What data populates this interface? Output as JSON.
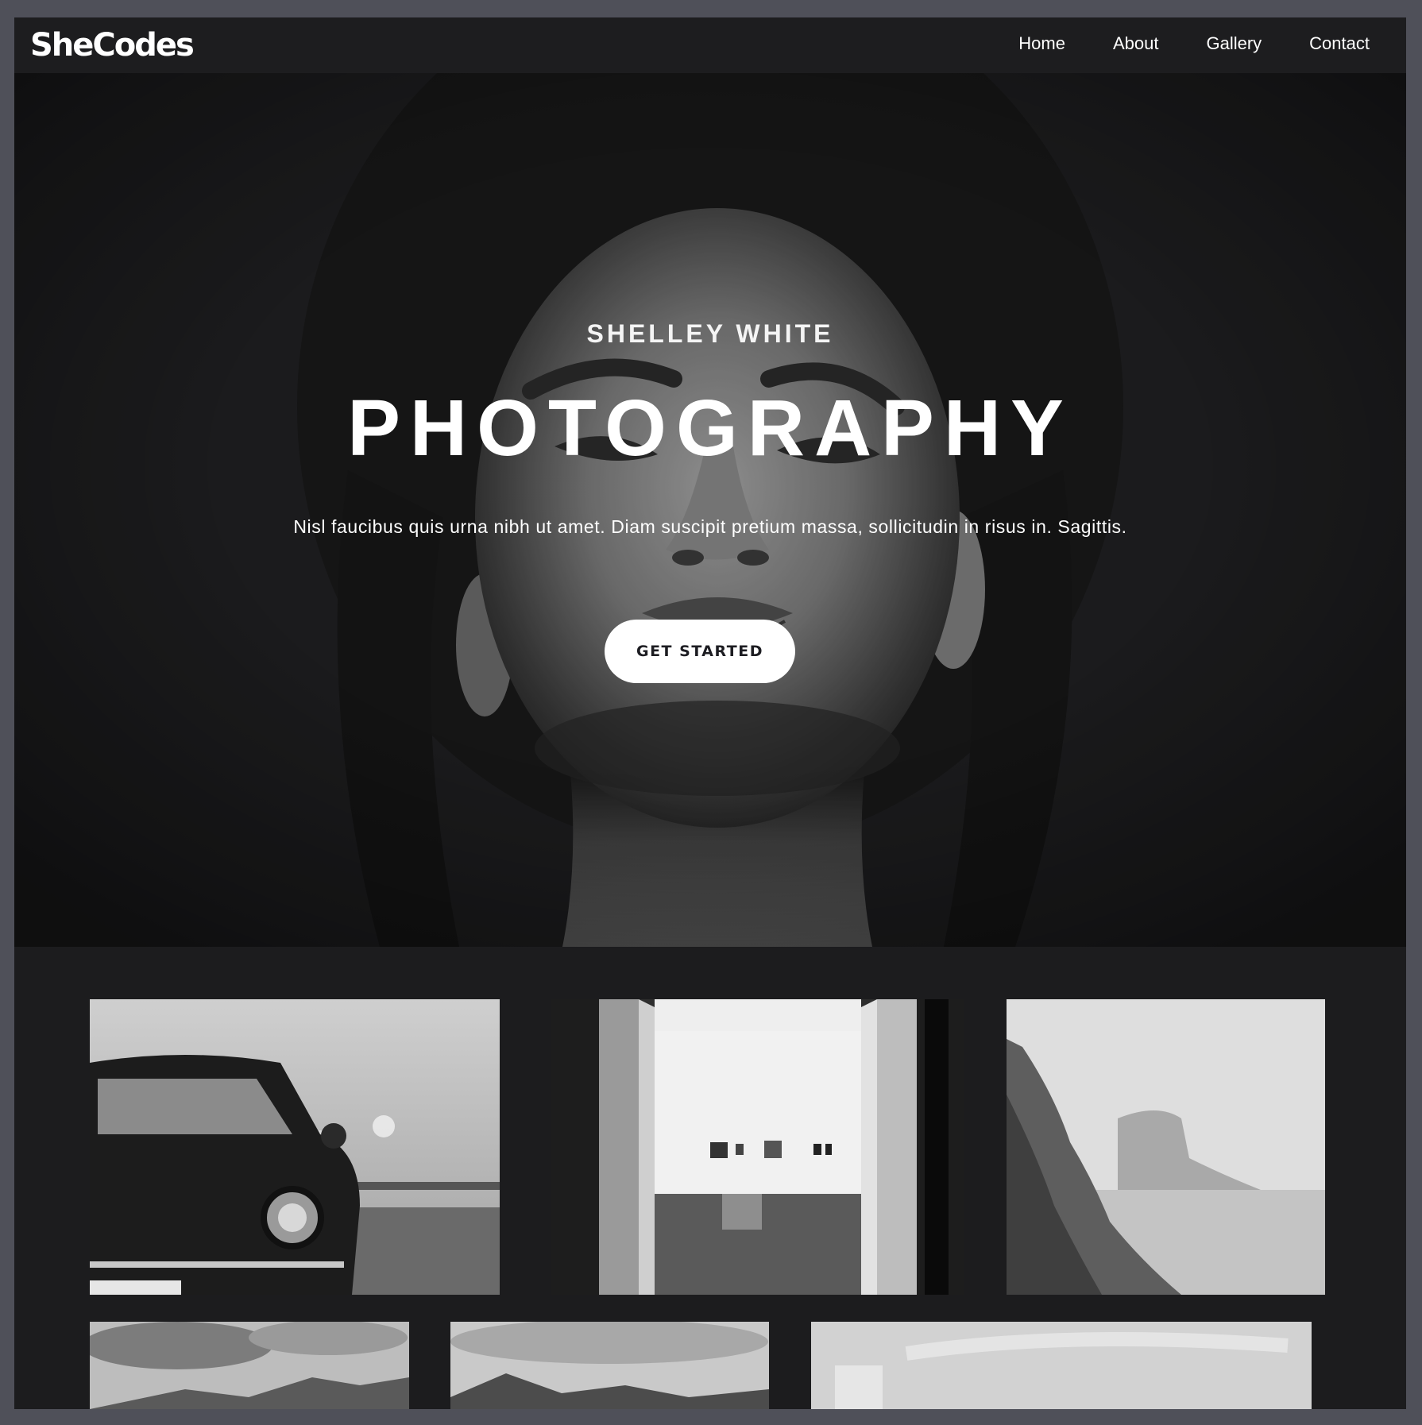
{
  "nav": {
    "logo": "SheCodes",
    "links": [
      {
        "label": "Home"
      },
      {
        "label": "About"
      },
      {
        "label": "Gallery"
      },
      {
        "label": "Contact"
      }
    ]
  },
  "hero": {
    "subtitle": "SHELLEY WHITE",
    "title": "PHOTOGRAPHY",
    "tagline": "Nisl faucibus quis urna nibh ut amet. Diam suscipit pretium massa, sollicitudin in risus in. Sagittis.",
    "cta_label": "GET STARTED"
  },
  "colors": {
    "page_bg": "#1c1c1e",
    "nav_bg": "#1d1d1f",
    "button_bg": "#ffffff",
    "button_text": "#1d1d22"
  },
  "gallery": {
    "images": [
      {
        "subject": "vintage-car"
      },
      {
        "subject": "gallery-interior"
      },
      {
        "subject": "sea-cliff"
      },
      {
        "subject": "mountains-clouds"
      },
      {
        "subject": "hills-landscape"
      },
      {
        "subject": "sky-building"
      }
    ]
  }
}
